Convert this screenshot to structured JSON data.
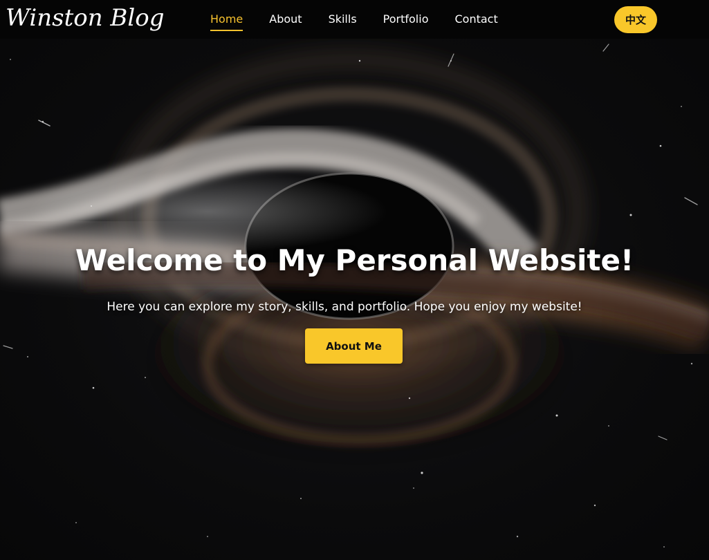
{
  "navbar": {
    "logo": "Winston Blog",
    "links": [
      {
        "label": "Home",
        "active": true
      },
      {
        "label": "About",
        "active": false
      },
      {
        "label": "Skills",
        "active": false
      },
      {
        "label": "Portfolio",
        "active": false
      },
      {
        "label": "Contact",
        "active": false
      }
    ],
    "language_button": "中文"
  },
  "hero": {
    "title": "Welcome to My Personal Website!",
    "subtitle": "Here you can explore my story, skills, and portfolio. Hope you enjoy my website!",
    "cta_label": "About Me",
    "background_icon": "black-hole-image"
  },
  "colors": {
    "accent": "#f9c72a",
    "navbar_bg": "#050505",
    "page_bg": "#0b0b0c",
    "text": "#ffffff"
  }
}
